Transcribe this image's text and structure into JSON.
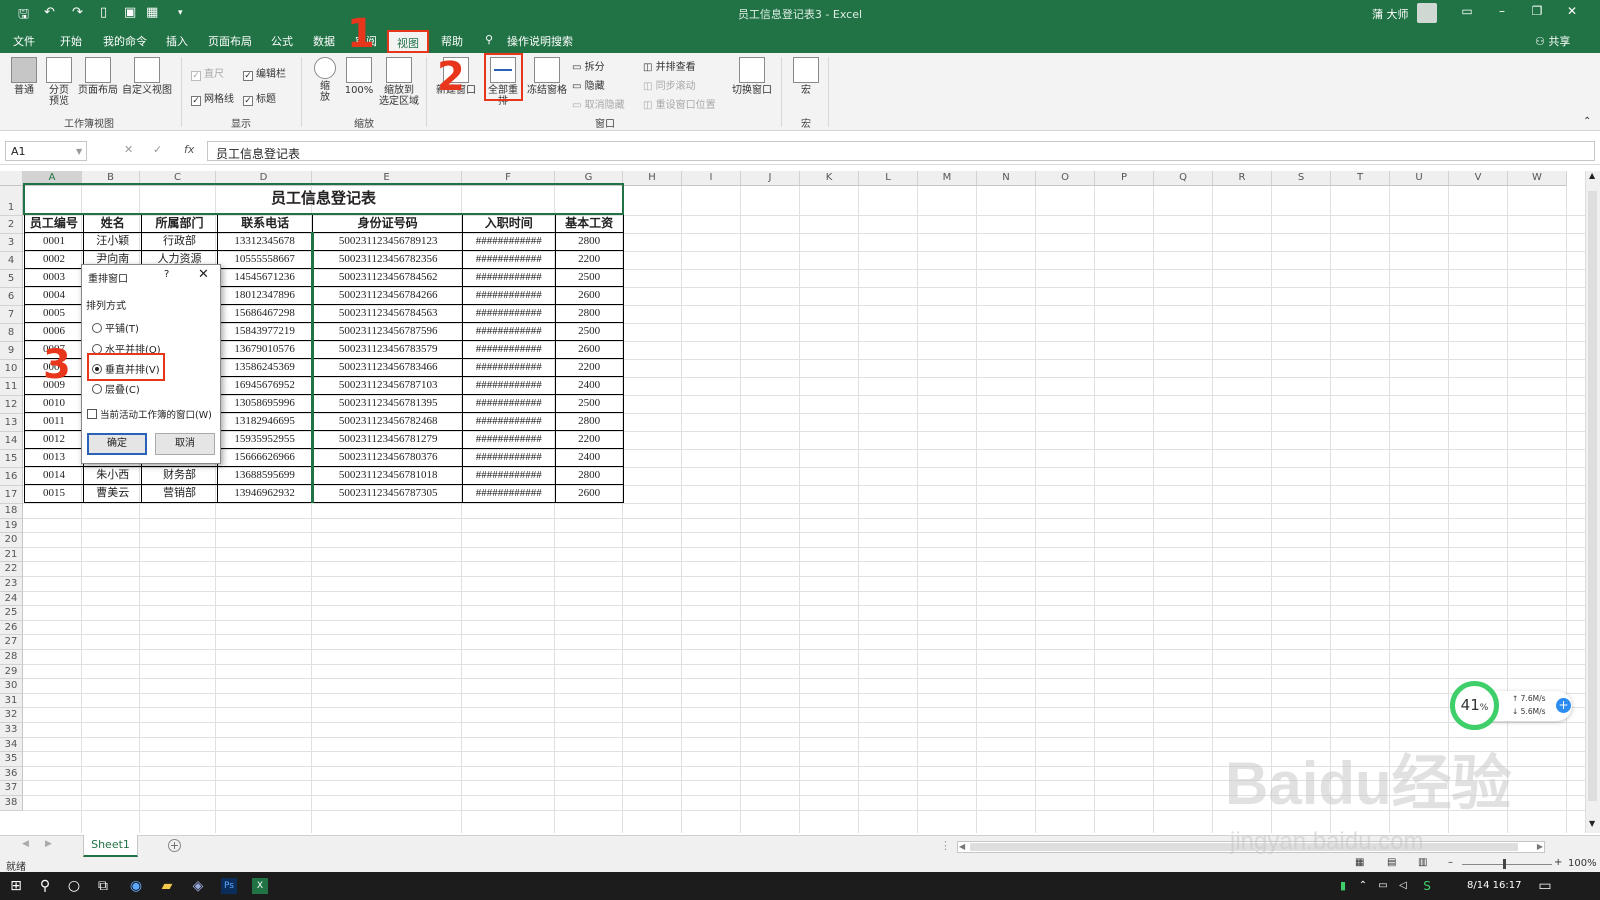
{
  "titlebar": {
    "title": "员工信息登记表3 - Excel",
    "user": "蒲 大师"
  },
  "menu": {
    "tabs": [
      "文件",
      "开始",
      "我的命令",
      "插入",
      "页面布局",
      "公式",
      "数据",
      "审阅",
      "视图",
      "帮助"
    ],
    "active": "视图",
    "search": "操作说明搜索",
    "share": "共享"
  },
  "ribbon": {
    "groups": {
      "workbook_views": "工作簿视图",
      "show": "显示",
      "zoom": "缩放",
      "window": "窗口",
      "macros": "宏"
    },
    "views": [
      "普通",
      "分页\n预览",
      "页面布局",
      "自定义视图"
    ],
    "show": {
      "ruler": "直尺",
      "formula_bar": "编辑栏",
      "gridlines": "网格线",
      "headings": "标题"
    },
    "zoom": [
      "缩\n放",
      "100%",
      "缩放到\n选定区域"
    ],
    "window": {
      "new": "新建窗口",
      "arrange": "全部重排",
      "freeze": "冻结窗格",
      "split": "拆分",
      "hide": "隐藏",
      "unhide": "取消隐藏",
      "side_by_side": "并排查看",
      "sync_scroll": "同步滚动",
      "reset_pos": "重设窗口位置",
      "switch": "切换窗口"
    },
    "macros": "宏"
  },
  "annotations": [
    "1",
    "2",
    "3"
  ],
  "formula_bar": {
    "namebox": "A1",
    "content": "员工信息登记表",
    "fx": "fx"
  },
  "columns": [
    "A",
    "B",
    "C",
    "D",
    "E",
    "F",
    "G",
    "H",
    "I",
    "J",
    "K",
    "L",
    "M",
    "N",
    "O",
    "P",
    "Q",
    "R",
    "S",
    "T",
    "U",
    "V",
    "W"
  ],
  "rows": [
    "1",
    "2",
    "3",
    "4",
    "5",
    "6",
    "7",
    "8",
    "9",
    "10",
    "11",
    "12",
    "13",
    "14",
    "15",
    "16",
    "17",
    "18",
    "19",
    "20",
    "21",
    "22",
    "23",
    "24",
    "25",
    "26",
    "27",
    "28",
    "29",
    "30",
    "31",
    "32",
    "33",
    "34",
    "35",
    "36",
    "37",
    "38"
  ],
  "table": {
    "title": "员工信息登记表",
    "headers": [
      "员工编号",
      "姓名",
      "所属部门",
      "联系电话",
      "身份证号码",
      "入职时间",
      "基本工资"
    ],
    "rows": [
      [
        "0001",
        "汪小颖",
        "行政部",
        "13312345678",
        "500231123456789123",
        "############",
        "2800"
      ],
      [
        "0002",
        "尹向南",
        "人力资源",
        "10555558667",
        "500231123456782356",
        "############",
        "2200"
      ],
      [
        "0003",
        "",
        "",
        "14545671236",
        "500231123456784562",
        "############",
        "2500"
      ],
      [
        "0004",
        "",
        "",
        "18012347896",
        "500231123456784266",
        "############",
        "2600"
      ],
      [
        "0005",
        "",
        "",
        "15686467298",
        "500231123456784563",
        "############",
        "2800"
      ],
      [
        "0006",
        "",
        "",
        "15843977219",
        "500231123456787596",
        "############",
        "2500"
      ],
      [
        "0007",
        "",
        "",
        "13679010576",
        "500231123456783579",
        "############",
        "2600"
      ],
      [
        "0008",
        "",
        "",
        "13586245369",
        "500231123456783466",
        "############",
        "2200"
      ],
      [
        "0009",
        "",
        "",
        "16945676952",
        "500231123456787103",
        "############",
        "2400"
      ],
      [
        "0010",
        "",
        "",
        "13058695996",
        "500231123456781395",
        "############",
        "2500"
      ],
      [
        "0011",
        "",
        "",
        "13182946695",
        "500231123456782468",
        "############",
        "2800"
      ],
      [
        "0012",
        "",
        "",
        "15935952955",
        "500231123456781279",
        "############",
        "2200"
      ],
      [
        "0013",
        "",
        "",
        "15666626966",
        "500231123456780376",
        "############",
        "2400"
      ],
      [
        "0014",
        "朱小西",
        "财务部",
        "13688595699",
        "500231123456781018",
        "############",
        "2800"
      ],
      [
        "0015",
        "曹美云",
        "营销部",
        "13946962932",
        "500231123456787305",
        "############",
        "2600"
      ]
    ]
  },
  "dialog": {
    "title": "重排窗口",
    "help": "?",
    "section": "排列方式",
    "options": [
      "平铺(T)",
      "水平并排(O)",
      "垂直并排(V)",
      "层叠(C)"
    ],
    "selected": "垂直并排(V)",
    "checkbox": "当前活动工作簿的窗口(W)",
    "ok": "确定",
    "cancel": "取消"
  },
  "sheet": {
    "tab": "Sheet1"
  },
  "status": {
    "text": "就绪",
    "zoom": "100%"
  },
  "taskbar": {
    "clock": "8/14 16:17"
  },
  "netmon": {
    "percent": "41",
    "unit": "%",
    "up": "7.6M/s",
    "down": "5.6M/s"
  },
  "watermark": {
    "main": "Baidu经验",
    "url": "jingyan.baidu.com"
  }
}
